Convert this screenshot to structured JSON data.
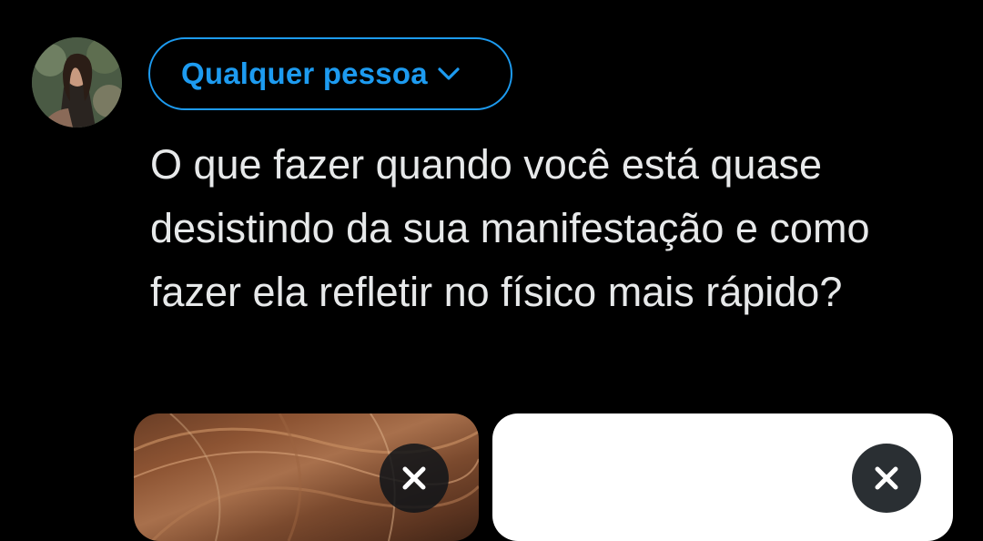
{
  "compose": {
    "avatar_icon": "user-avatar",
    "audience": {
      "label": "Qualquer pessoa",
      "icon": "chevron-down-icon",
      "color": "#1d9bf0"
    },
    "text": "O que fazer quando você está quase desistindo da sua manifestação e como fazer ela refletir no físico mais rápido?",
    "text_color": "#e7e9ea",
    "background": "#000000",
    "media": [
      {
        "kind": "photo",
        "remove_icon": "close-icon"
      },
      {
        "kind": "image",
        "remove_icon": "close-icon"
      }
    ]
  }
}
